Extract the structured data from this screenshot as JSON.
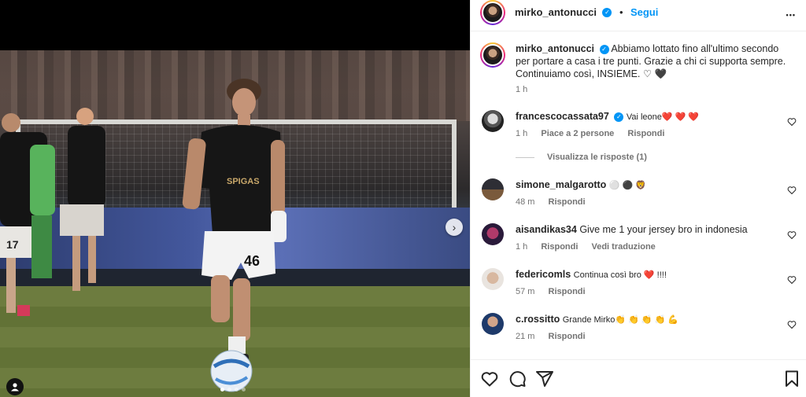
{
  "post": {
    "author": "mirko_antonucci",
    "separator": "•",
    "follow_label": "Segui",
    "more_label": "•••",
    "caption": "Abbiamo lottato fino all'ultimo secondo per portare a casa i tre punti. Grazie a chi ci supporta sempre. Continuiamo così, INSIEME. ♡ 🖤",
    "caption_time": "1 h"
  },
  "media": {
    "jersey_number": "46",
    "sponsor": "SPIGAS",
    "carousel_count": 4,
    "carousel_active": 1,
    "next_arrow": "›"
  },
  "comments": [
    {
      "username": "francescocassata97",
      "verified": true,
      "text": "Vai leone❤️ ❤️ ❤️",
      "time": "1 h",
      "likes": "Piace a 2 persone",
      "reply": "Rispondi",
      "view_replies": "Visualizza le risposte (1)"
    },
    {
      "username": "simone_malgarotto",
      "text": "⚪ ⚫ 🦁",
      "time": "48 m",
      "reply": "Rispondi"
    },
    {
      "username": "aisandikas34",
      "text": "Give me 1 your jersey bro in indonesia",
      "time": "1 h",
      "reply": "Rispondi",
      "translate": "Vedi traduzione"
    },
    {
      "username": "federicomls",
      "text": "Continua così bro ❤️ !!!!",
      "time": "57 m",
      "reply": "Rispondi"
    },
    {
      "username": "c.rossitto",
      "text": "Grande Mirko👏 👏 👏 👏 💪",
      "time": "21 m",
      "reply": "Rispondi"
    }
  ],
  "colors": {
    "accent": "#0095f6",
    "text": "#262626",
    "muted": "#737373",
    "border": "#efefef"
  }
}
